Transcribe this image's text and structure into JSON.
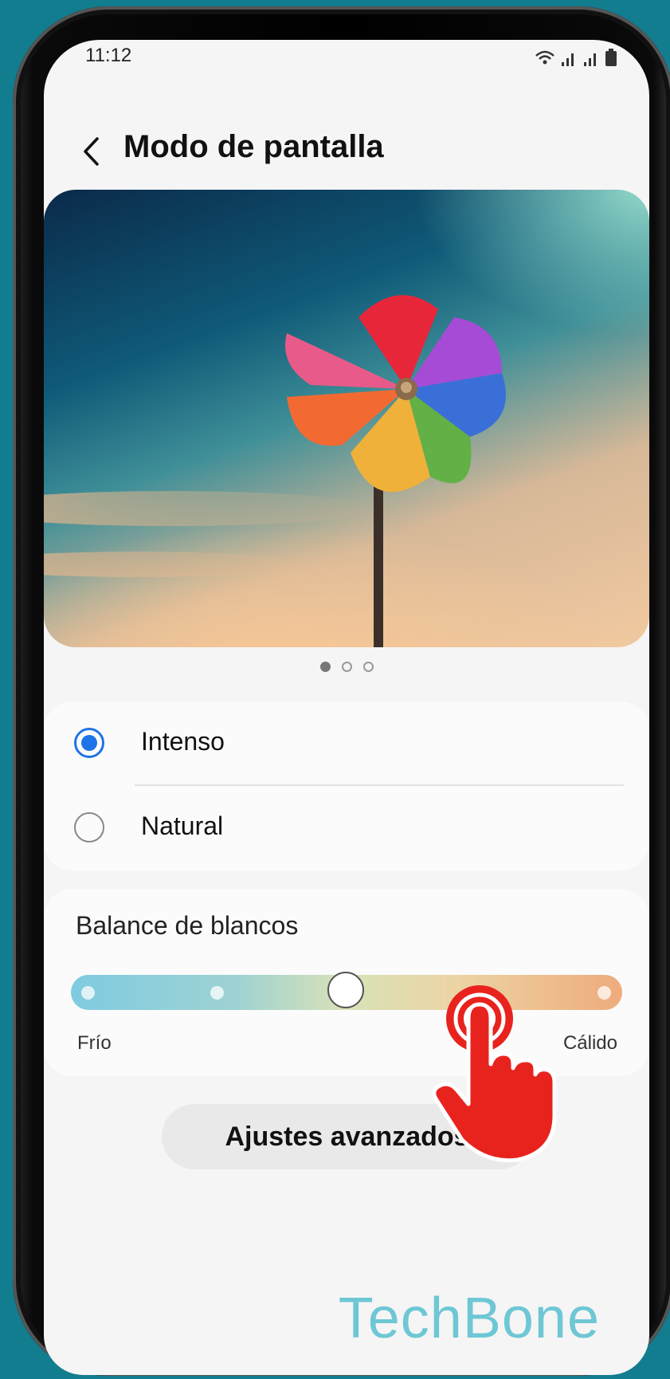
{
  "status_bar": {
    "time": "11:12",
    "icons": [
      "wifi-icon",
      "signal-icon",
      "signal-icon",
      "battery-icon"
    ]
  },
  "header": {
    "back_icon": "chevron-left-icon",
    "title": "Modo de pantalla"
  },
  "preview": {
    "page_count": 3,
    "active_page": 1
  },
  "screen_modes": {
    "options": [
      {
        "label": "Intenso",
        "selected": true
      },
      {
        "label": "Natural",
        "selected": false
      }
    ]
  },
  "white_balance": {
    "title": "Balance de blancos",
    "min_label": "Frío",
    "max_label": "Cálido",
    "steps": 5,
    "current_step": 3
  },
  "advanced_button": {
    "label": "Ajustes avanzados"
  },
  "watermark": "TechBone",
  "colors": {
    "accent": "#1e73e8",
    "background": "#127d8f",
    "pointer_hand": "#e8231e"
  }
}
